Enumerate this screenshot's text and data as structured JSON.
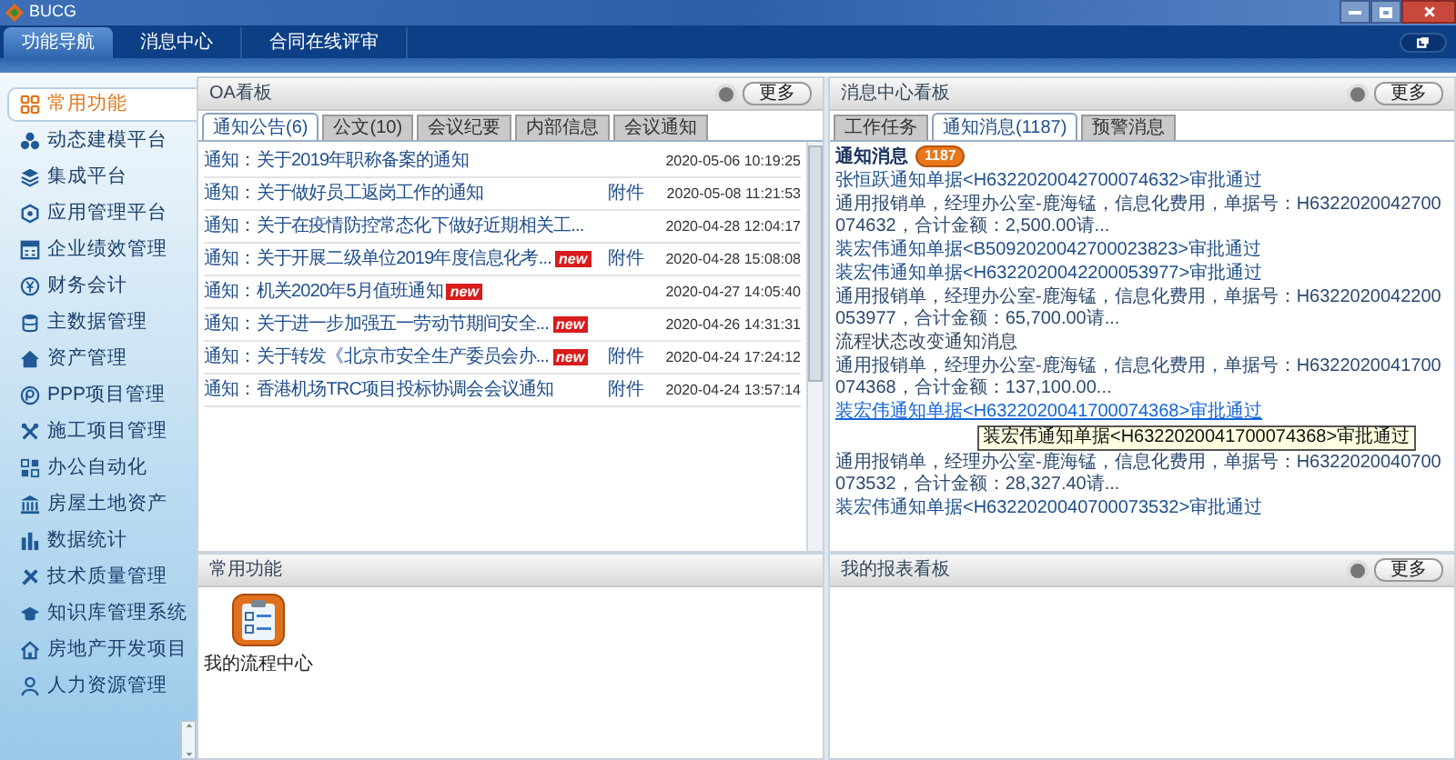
{
  "window": {
    "title": "BUCG"
  },
  "nav_tabs": [
    {
      "label": "功能导航",
      "selected": true
    },
    {
      "label": "消息中心",
      "selected": false
    },
    {
      "label": "合同在线评审",
      "selected": false
    }
  ],
  "sidebar": {
    "items": [
      {
        "label": "常用功能",
        "selected": true
      },
      {
        "label": "动态建模平台",
        "selected": false
      },
      {
        "label": "集成平台",
        "selected": false
      },
      {
        "label": "应用管理平台",
        "selected": false
      },
      {
        "label": "企业绩效管理",
        "selected": false
      },
      {
        "label": "财务会计",
        "selected": false
      },
      {
        "label": "主数据管理",
        "selected": false
      },
      {
        "label": "资产管理",
        "selected": false
      },
      {
        "label": "PPP项目管理",
        "selected": false
      },
      {
        "label": "施工项目管理",
        "selected": false
      },
      {
        "label": "办公自动化",
        "selected": false
      },
      {
        "label": "房屋土地资产",
        "selected": false
      },
      {
        "label": "数据统计",
        "selected": false
      },
      {
        "label": "技术质量管理",
        "selected": false
      },
      {
        "label": "知识库管理系统",
        "selected": false
      },
      {
        "label": "房地产开发项目",
        "selected": false
      },
      {
        "label": "人力资源管理",
        "selected": false
      }
    ]
  },
  "oa_panel": {
    "title": "OA看板",
    "more": "更多",
    "tabs": [
      {
        "label": "通知公告(6)",
        "selected": true
      },
      {
        "label": "公文(10)",
        "selected": false
      },
      {
        "label": "会议纪要",
        "selected": false
      },
      {
        "label": "内部信息",
        "selected": false
      },
      {
        "label": "会议通知",
        "selected": false
      }
    ],
    "rows": [
      {
        "title": "通知：关于2019年职称备案的通知",
        "time": "2020-05-06 10:19:25"
      },
      {
        "title": "通知：关于做好员工返岗工作的通知",
        "attachment": "附件",
        "time": "2020-05-08 11:21:53"
      },
      {
        "title": "通知：关于在疫情防控常态化下做好近期相关工...",
        "time": "2020-04-28 12:04:17"
      },
      {
        "title": "通知：关于开展二级单位2019年度信息化考...",
        "badge": "new",
        "attachment": "附件",
        "time": "2020-04-28 15:08:08"
      },
      {
        "title": "通知：机关2020年5月值班通知",
        "badge": "new",
        "time": "2020-04-27 14:05:40"
      },
      {
        "title": "通知：关于进一步加强五一劳动节期间安全...",
        "badge": "new",
        "time": "2020-04-26 14:31:31"
      },
      {
        "title": "通知：关于转发《北京市安全生产委员会办...",
        "badge": "new",
        "attachment": "附件",
        "time": "2020-04-24 17:24:12"
      },
      {
        "title": "通知：香港机场TRC项目投标协调会会议通知",
        "attachment": "附件",
        "time": "2020-04-24 13:57:14"
      }
    ]
  },
  "message_panel": {
    "title": "消息中心看板",
    "more": "更多",
    "tabs": [
      {
        "label": "工作任务",
        "selected": false
      },
      {
        "label": "通知消息(1187)",
        "selected": true
      },
      {
        "label": "预警消息",
        "selected": false
      }
    ],
    "heading": "通知消息",
    "count": "1187",
    "messages": [
      {
        "kind": "link",
        "text": "张恒跃通知单据<H6322020042700074632>审批通过",
        "hovered": false
      },
      {
        "kind": "detail",
        "text": "通用报销单，经理办公室-鹿海锰，信息化费用，单据号：H6322020042700074632，合计金额：2,500.00请..."
      },
      {
        "kind": "link",
        "text": "装宏伟通知单据<B5092020042700023823>审批通过",
        "hovered": false
      },
      {
        "kind": "link",
        "text": "装宏伟通知单据<H6322020042200053977>审批通过",
        "hovered": false
      },
      {
        "kind": "detail",
        "text": "通用报销单，经理办公室-鹿海锰，信息化费用，单据号：H6322020042200053977，合计金额：65,700.00请..."
      },
      {
        "kind": "plain",
        "text": "流程状态改变通知消息"
      },
      {
        "kind": "detail",
        "text": "通用报销单，经理办公室-鹿海锰，信息化费用，单据号：H6322020041700074368，合计金额：137,100.00..."
      },
      {
        "kind": "link",
        "text": "装宏伟通知单据<H6322020041700074368>审批通过",
        "hovered": true,
        "tooltip": "装宏伟通知单据<H6322020041700074368>审批通过"
      },
      {
        "kind": "detail",
        "text": "通用报销单，经理办公室-鹿海锰，信息化费用，单据号：H6322020040700073532，合计金额：28,327.40请..."
      },
      {
        "kind": "link",
        "text": "装宏伟通知单据<H6322020040700073532>审批通过",
        "hovered": false
      }
    ]
  },
  "shortcuts_panel": {
    "title": "常用功能",
    "items": [
      {
        "label": "我的流程中心"
      }
    ]
  },
  "report_panel": {
    "title": "我的报表看板",
    "more": "更多"
  }
}
